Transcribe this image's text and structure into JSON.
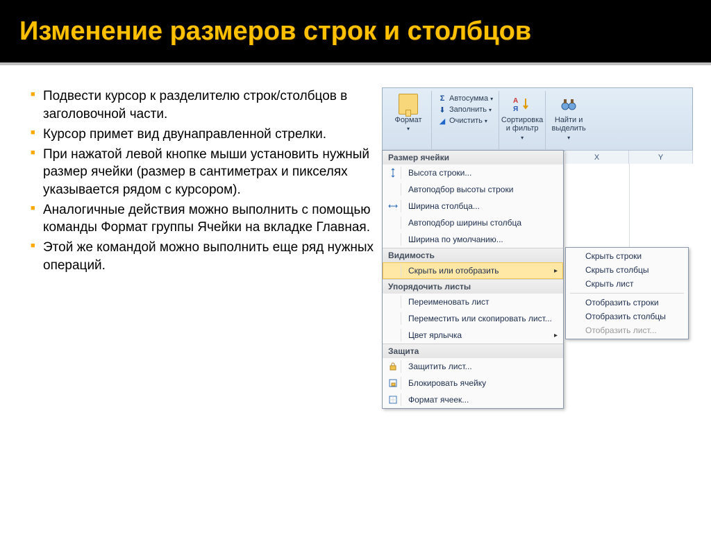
{
  "title": "Изменение размеров строк и столбцов",
  "bullets": [
    "Подвести курсор к разделителю строк/столбцов в заголовочной части.",
    "Курсор примет вид двунаправленной стрелки.",
    "При нажатой левой кнопке мыши установить нужный размер ячейки (размер в сантиметрах и пикселях указывается рядом с курсором).",
    "Аналогичные действия можно выполнить с помощью команды Формат группы Ячейки на вкладке Главная.",
    "Этой же командой можно выполнить еще ряд нужных операций."
  ],
  "ribbon": {
    "format": "Формат",
    "autosum": "Автосумма",
    "fill": "Заполнить",
    "clear": "Очистить",
    "sort": "Сортировка и фильтр",
    "find": "Найти и выделить"
  },
  "menu": {
    "sections": {
      "cell_size": "Размер ячейки",
      "visibility": "Видимость",
      "organize": "Упорядочить листы",
      "protection": "Защита"
    },
    "items": {
      "row_height": "Высота строки...",
      "autofit_row": "Автоподбор высоты строки",
      "col_width": "Ширина столбца...",
      "autofit_col": "Автоподбор ширины столбца",
      "default_width": "Ширина по умолчанию...",
      "hide_show": "Скрыть или отобразить",
      "rename_sheet": "Переименовать лист",
      "move_copy": "Переместить или скопировать лист...",
      "tab_color": "Цвет ярлычка",
      "protect_sheet": "Защитить лист...",
      "lock_cell": "Блокировать ячейку",
      "format_cells": "Формат ячеек..."
    }
  },
  "submenu": {
    "hide_rows": "Скрыть строки",
    "hide_cols": "Скрыть столбцы",
    "hide_sheet": "Скрыть лист",
    "show_rows": "Отобразить строки",
    "show_cols": "Отобразить столбцы",
    "show_sheet": "Отобразить лист..."
  },
  "grid_cols": [
    "X",
    "Y"
  ]
}
